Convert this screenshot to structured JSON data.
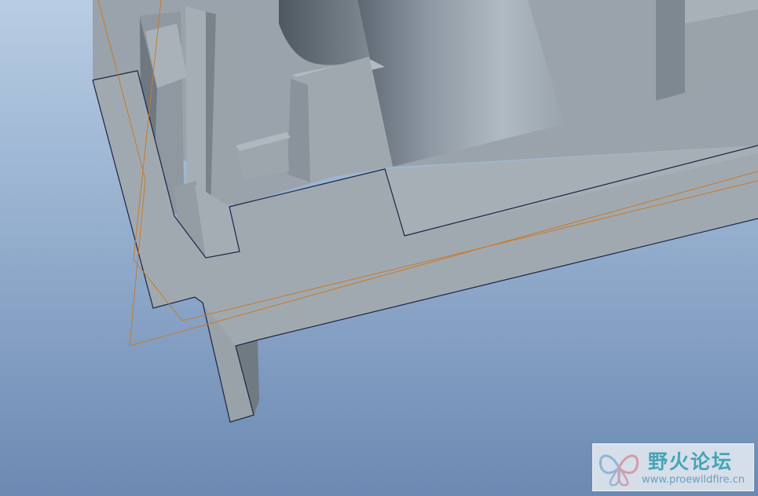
{
  "viewport": {
    "background_top": "#b9cde3",
    "background_bottom": "#6b89b2",
    "model_color": "#a1a9b0",
    "edge_color": "#1a2548",
    "datum_color": "#c87a2a"
  },
  "watermark": {
    "title": "野火论坛",
    "url": "www.proewildfire.cn",
    "logo_icon": "butterfly-logo-icon"
  }
}
